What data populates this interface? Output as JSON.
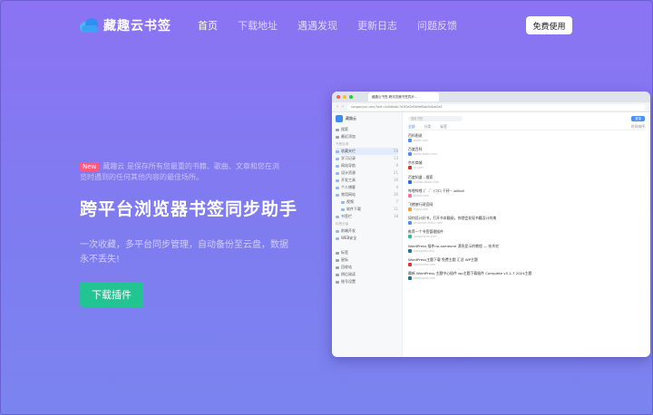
{
  "brand": {
    "name": "藏趣云书签"
  },
  "nav": {
    "links": [
      {
        "label": "首页",
        "active": true
      },
      {
        "label": "下载地址",
        "active": false
      },
      {
        "label": "遇遇发现",
        "active": false
      },
      {
        "label": "更新日志",
        "active": false
      },
      {
        "label": "问题反馈",
        "active": false
      }
    ],
    "cta_label": "免费使用"
  },
  "hero": {
    "badge": "New",
    "note": "藏趣云 是保存所有您最重的书籍、歌曲、文章和您在浏览时遇到的任何其他内容的最佳场所。",
    "title": "跨平台浏览器书签同步助手",
    "subtitle": "一次收藏，多平台同步管理，自动备份至云盘，数据永不丢失!",
    "button_label": "下载插件"
  },
  "mockup": {
    "tab_title": "藏趣云书签-跨浏览器书签同步...",
    "url": "songquyun.com/?aid=0s0d0a0c7d3f0a5d5b9ef0ab5c6dc0a5",
    "sidebar": {
      "title": "藏趣云",
      "items": [
        {
          "label": "搜索",
          "count": ""
        },
        {
          "label": "最近添加",
          "count": ""
        }
      ],
      "group1": "书签目录",
      "folders": [
        {
          "label": "收藏夹栏",
          "count": "58",
          "selected": true
        },
        {
          "label": "学习记录",
          "count": "13",
          "selected": false
        },
        {
          "label": "网站导航",
          "count": "9",
          "selected": false
        },
        {
          "label": "设计资源",
          "count": "21",
          "selected": false
        },
        {
          "label": "开发工具",
          "count": "16",
          "selected": false
        },
        {
          "label": "个人博客",
          "count": "4",
          "selected": false
        },
        {
          "label": "常用网站",
          "count": "36",
          "selected": false
        },
        {
          "label": "视频",
          "count": "7",
          "selected": false
        },
        {
          "label": "软件下载",
          "count": "11",
          "selected": false
        },
        {
          "label": "书签栏",
          "count": "18",
          "selected": false
        }
      ],
      "group2": "标签分组",
      "tags": [
        {
          "label": "前端开发",
          "count": ""
        },
        {
          "label": "WEB安全",
          "count": ""
        }
      ],
      "group3": "",
      "bottom": [
        {
          "label": "标签"
        },
        {
          "label": "星标"
        },
        {
          "label": "回收站"
        },
        {
          "label": "稍后阅读"
        },
        {
          "label": "账号设置"
        }
      ]
    },
    "search_placeholder": "搜索书签",
    "login_label": "登录",
    "tabs": {
      "a": "全部",
      "b": "分类",
      "c": "标签",
      "sort": "时间排序"
    },
    "bookmarks": [
      {
        "title": "百科图说",
        "url": "baike.com"
      },
      {
        "title": "百度百科",
        "url": "baike.baidu.com"
      },
      {
        "title": "京东商城",
        "url": "jd.com"
      },
      {
        "title": "百度知道 - 搜索",
        "url": "zhidao.baidu.com"
      },
      {
        "title": "哔哩哔哩 (゜-゜)つロ 干杯~-bilibili",
        "url": "bilibili.com"
      },
      {
        "title": "飞猪旅行网官网",
        "url": "fliggy.com"
      },
      {
        "title": "如何设计好书，打开书本翻阅，你就会发现书籍设计的美",
        "url": "zhuanlan.zhihu.com"
      },
      {
        "title": "推荐一个书签管理插件",
        "url": "songquyun.com"
      },
      {
        "title": "WordPress 插件no-someone 漂亮显示的教程 — 技术宅",
        "url": "wordpress.org"
      },
      {
        "title": "WordPress主题下载 免费主题 汇总 WP主题",
        "url": "wpthemes.com"
      },
      {
        "title": "最新 WordPress 主题中心插件 wp主题下载插件 Complete v5.1.7 2024主题",
        "url": "wpplugins.com"
      }
    ]
  },
  "colors": {
    "bg_top": "#8b73f3",
    "bg_bottom": "#7a84ef",
    "accent_green": "#22c591",
    "badge_red": "#ff5b7d",
    "mock_blue": "#4d92f3"
  }
}
